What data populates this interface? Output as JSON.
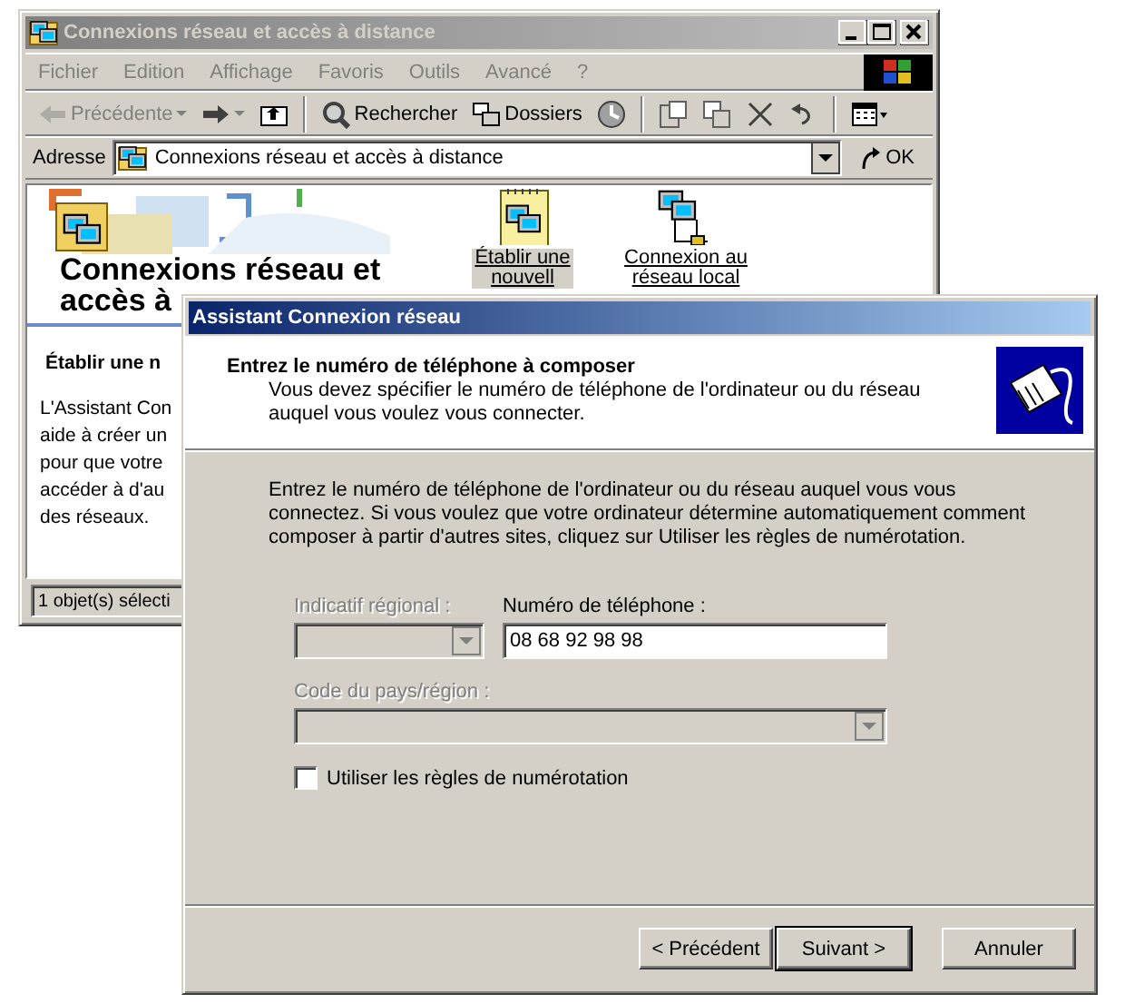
{
  "explorer": {
    "title": "Connexions réseau et accès à distance",
    "menu": [
      "Fichier",
      "Edition",
      "Affichage",
      "Favoris",
      "Outils",
      "Avancé",
      "?"
    ],
    "toolbar": [
      {
        "kind": "back",
        "label": "Précédente",
        "disabled": true
      },
      {
        "kind": "forward",
        "disabled": false
      },
      {
        "kind": "up",
        "disabled": false
      },
      {
        "kind": "sep"
      },
      {
        "kind": "search",
        "label": "Rechercher",
        "disabled": false
      },
      {
        "kind": "folders",
        "label": "Dossiers",
        "disabled": false
      },
      {
        "kind": "history",
        "disabled": false
      },
      {
        "kind": "sep"
      },
      {
        "kind": "move",
        "disabled": false
      },
      {
        "kind": "copy",
        "disabled": false
      },
      {
        "kind": "delete",
        "disabled": false
      },
      {
        "kind": "undo",
        "disabled": false
      },
      {
        "kind": "sep"
      },
      {
        "kind": "views",
        "disabled": false
      }
    ],
    "address": {
      "label": "Adresse",
      "value": "Connexions réseau et accès à distance",
      "go": "OK"
    },
    "heading_lines": [
      "Connexions réseau et",
      "accès à"
    ],
    "task_title": "Établir une n",
    "task_lines": [
      "L'Assistant Con",
      "aide à créer un",
      "pour que votre",
      "accéder à d'au",
      "des réseaux."
    ],
    "items": [
      {
        "kind": "new",
        "label_lines": [
          "Établir une",
          "nouvell"
        ],
        "selected": true
      },
      {
        "kind": "lan",
        "label_lines": [
          "Connexion au",
          "réseau local"
        ],
        "selected": false
      }
    ],
    "status": "1 objet(s) sélecti"
  },
  "dialog": {
    "title": "Assistant Connexion réseau",
    "header_title": "Entrez le numéro de téléphone à composer",
    "header_subtitle": "Vous devez spécifier le numéro de téléphone de l'ordinateur ou du réseau auquel vous voulez vous connecter.",
    "intro": "Entrez le numéro de téléphone de l'ordinateur ou du réseau auquel vous vous connectez. Si vous voulez que votre ordinateur détermine automatiquement comment composer à partir d'autres sites, cliquez sur Utiliser les règles de numérotation.",
    "area_code": {
      "label": "Indicatif régional :",
      "disabled": true
    },
    "phone": {
      "label": "Numéro de téléphone :",
      "value": "08 68 92 98 98"
    },
    "country": {
      "label": "Code du pays/région :",
      "disabled": true
    },
    "dialing_rules": {
      "label": "Utiliser les règles de numérotation",
      "checked": false
    },
    "buttons": [
      {
        "label": "< Précédent",
        "default": false
      },
      {
        "label": "Suivant >",
        "default": true
      },
      {
        "label": "Annuler",
        "default": false
      }
    ]
  }
}
